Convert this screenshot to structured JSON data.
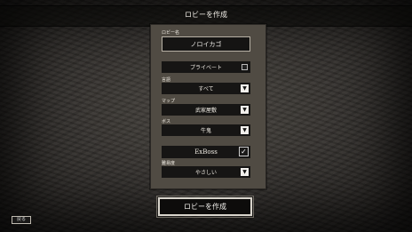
{
  "header": {
    "title": "ロビーを作成"
  },
  "form": {
    "lobby_name_label": "ロビー名",
    "lobby_name_value": "ノロイカゴ",
    "private_label": "プライベート",
    "language_label": "言語",
    "language_value": "すべて",
    "map_label": "マップ",
    "map_value": "武家屋敷",
    "boss_label": "ボス",
    "boss_value": "牛鬼",
    "exboss_label": "ExBoss",
    "difficulty_label": "難易度",
    "difficulty_value": "やさしい",
    "dropdown_arrow": "▼",
    "check_mark": "✓"
  },
  "actions": {
    "create_label": "ロビーを作成",
    "back_label": "戻る"
  }
}
